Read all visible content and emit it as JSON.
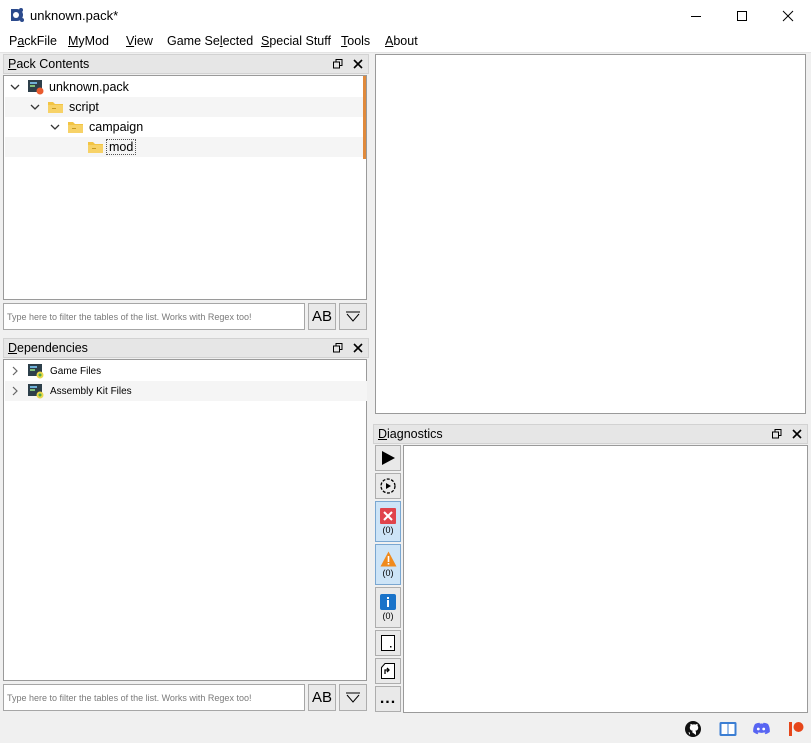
{
  "window": {
    "title": "unknown.pack*"
  },
  "menu": {
    "packfile": {
      "before": "P",
      "u": "a",
      "after": "ckFile"
    },
    "mymod": {
      "before": "",
      "u": "M",
      "after": "yMod"
    },
    "view": {
      "before": "",
      "u": "V",
      "after": "iew"
    },
    "game_selected": {
      "before": "Game Se",
      "u": "l",
      "after": "ected"
    },
    "special_stuff": {
      "before": "",
      "u": "S",
      "after": "pecial Stuff"
    },
    "tools": {
      "before": "",
      "u": "T",
      "after": "ools"
    },
    "about": {
      "before": "",
      "u": "A",
      "after": "bout"
    }
  },
  "pack_contents": {
    "title_u": "P",
    "title_rest": "ack Contents",
    "tree": [
      {
        "label": "unknown.pack",
        "icon": "pack-icon",
        "expanded": true
      },
      {
        "label": "script",
        "icon": "folder-icon",
        "expanded": true
      },
      {
        "label": "campaign",
        "icon": "folder-icon",
        "expanded": true
      },
      {
        "label": "mod",
        "icon": "folder-icon",
        "selected": true
      }
    ],
    "filter_placeholder": "Type here to filter the tables of the list. Works with Regex too!"
  },
  "dependencies": {
    "title_u": "D",
    "title_rest": "ependencies",
    "tree": [
      {
        "label": "Game Files",
        "icon": "pack-icon",
        "expanded": false
      },
      {
        "label": "Assembly Kit Files",
        "icon": "pack-icon",
        "expanded": false
      }
    ],
    "filter_placeholder": "Type here to filter the tables of the list. Works with Regex too!"
  },
  "diagnostics": {
    "title_u": "D",
    "title_rest": "iagnostics",
    "error_count": "(0)",
    "warning_count": "(0)",
    "info_count": "(0)",
    "more_label": "..."
  },
  "toolbar": {
    "case_label": "AB"
  },
  "colors": {
    "accent_scroll": "#e08a3c",
    "error": "#e0434b",
    "warning": "#f08a1c",
    "info": "#1a73c9",
    "patreon": "#e6461a",
    "discord": "#5865f2"
  }
}
